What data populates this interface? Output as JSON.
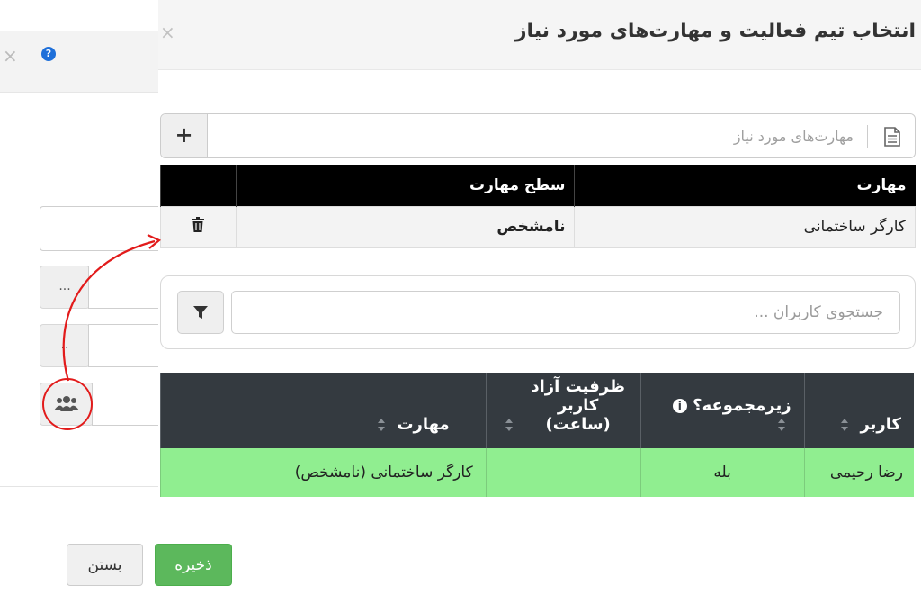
{
  "background": {
    "close_symbol": "×",
    "help_symbol": "?",
    "ellipsis_1": "...",
    "ellipsis_2": "..",
    "team_icon": "users-icon"
  },
  "modal": {
    "title": "انتخاب تیم فعالیت و مهارت‌های مورد نیاز",
    "close_symbol": "×",
    "skills": {
      "placeholder": "مهارت‌های مورد نیاز",
      "add_symbol": "+",
      "columns": [
        "مهارت",
        "سطح مهارت",
        ""
      ],
      "rows": [
        {
          "skill": "کارگر ساختمانی",
          "level": "نامشخص"
        }
      ]
    },
    "search": {
      "placeholder": "جستجوی کاربران ..."
    },
    "users": {
      "columns": [
        "کاربر",
        "زیرمجموعه؟",
        "ظرفیت آزاد کاربر (ساعت)",
        "مهارت"
      ],
      "rows": [
        {
          "user": "رضا رحیمی",
          "subset": "بله",
          "capacity": "",
          "skill": "کارگر ساختمانی (نامشخص)"
        }
      ]
    }
  },
  "footer": {
    "save_label": "ذخیره",
    "close_label": "بستن"
  },
  "colors": {
    "accent_green": "#5cb85c",
    "row_highlight": "#90ee90",
    "annotation_red": "#e21b1b",
    "header_dark": "#343a40"
  }
}
